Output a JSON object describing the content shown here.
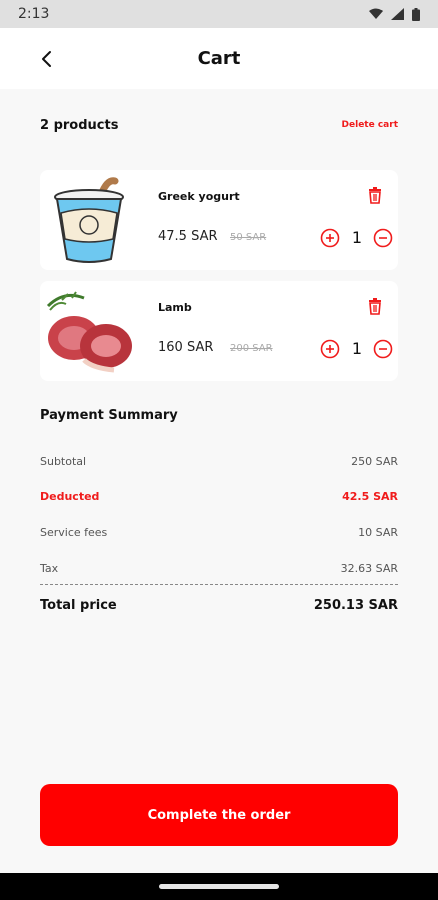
{
  "status_bar": {
    "time": "2:13",
    "icons": [
      "wifi-icon",
      "signal-icon",
      "battery-icon"
    ]
  },
  "header": {
    "title": "Cart",
    "back_icon": "chevron-left-icon"
  },
  "cart": {
    "products_count": "2 products",
    "delete_label": "Delete cart"
  },
  "products": [
    {
      "name": "Greek yogurt",
      "price": "47.5 SAR",
      "old_price": "50 SAR",
      "quantity": "1",
      "image": "yogurt-cup"
    },
    {
      "name": "Lamb",
      "price": "160 SAR",
      "old_price": "200 SAR",
      "quantity": "1",
      "image": "lamb-meat"
    }
  ],
  "summary": {
    "title": "Payment Summary",
    "subtotal_label": "Subtotal",
    "subtotal_value": "250 SAR",
    "deducted_label": "Deducted",
    "deducted_value": "42.5 SAR",
    "service_label": "Service fees",
    "service_value": "10 SAR",
    "tax_label": "Tax",
    "tax_value": "32.63 SAR",
    "total_label": "Total price",
    "total_value": "250.13 SAR"
  },
  "actions": {
    "complete_label": "Complete the order"
  },
  "colors": {
    "accent": "#ff0000",
    "text": "#111111",
    "muted": "#aaaaaa",
    "background": "#f8f8f8"
  }
}
